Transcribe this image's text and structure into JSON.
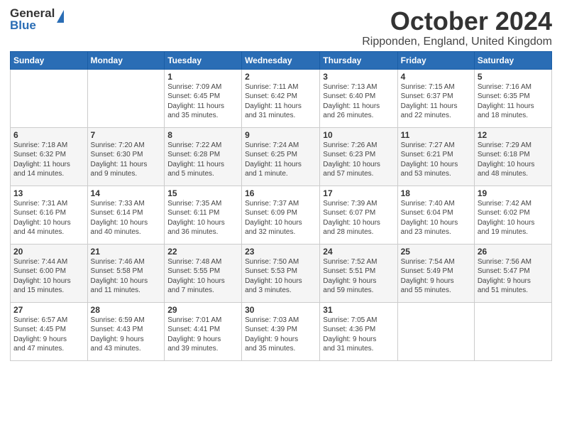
{
  "header": {
    "logo_line1": "General",
    "logo_line2": "Blue",
    "month_title": "October 2024",
    "location": "Ripponden, England, United Kingdom"
  },
  "days_of_week": [
    "Sunday",
    "Monday",
    "Tuesday",
    "Wednesday",
    "Thursday",
    "Friday",
    "Saturday"
  ],
  "weeks": [
    [
      {
        "day": "",
        "info": ""
      },
      {
        "day": "",
        "info": ""
      },
      {
        "day": "1",
        "info": "Sunrise: 7:09 AM\nSunset: 6:45 PM\nDaylight: 11 hours\nand 35 minutes."
      },
      {
        "day": "2",
        "info": "Sunrise: 7:11 AM\nSunset: 6:42 PM\nDaylight: 11 hours\nand 31 minutes."
      },
      {
        "day": "3",
        "info": "Sunrise: 7:13 AM\nSunset: 6:40 PM\nDaylight: 11 hours\nand 26 minutes."
      },
      {
        "day": "4",
        "info": "Sunrise: 7:15 AM\nSunset: 6:37 PM\nDaylight: 11 hours\nand 22 minutes."
      },
      {
        "day": "5",
        "info": "Sunrise: 7:16 AM\nSunset: 6:35 PM\nDaylight: 11 hours\nand 18 minutes."
      }
    ],
    [
      {
        "day": "6",
        "info": "Sunrise: 7:18 AM\nSunset: 6:32 PM\nDaylight: 11 hours\nand 14 minutes."
      },
      {
        "day": "7",
        "info": "Sunrise: 7:20 AM\nSunset: 6:30 PM\nDaylight: 11 hours\nand 9 minutes."
      },
      {
        "day": "8",
        "info": "Sunrise: 7:22 AM\nSunset: 6:28 PM\nDaylight: 11 hours\nand 5 minutes."
      },
      {
        "day": "9",
        "info": "Sunrise: 7:24 AM\nSunset: 6:25 PM\nDaylight: 11 hours\nand 1 minute."
      },
      {
        "day": "10",
        "info": "Sunrise: 7:26 AM\nSunset: 6:23 PM\nDaylight: 10 hours\nand 57 minutes."
      },
      {
        "day": "11",
        "info": "Sunrise: 7:27 AM\nSunset: 6:21 PM\nDaylight: 10 hours\nand 53 minutes."
      },
      {
        "day": "12",
        "info": "Sunrise: 7:29 AM\nSunset: 6:18 PM\nDaylight: 10 hours\nand 48 minutes."
      }
    ],
    [
      {
        "day": "13",
        "info": "Sunrise: 7:31 AM\nSunset: 6:16 PM\nDaylight: 10 hours\nand 44 minutes."
      },
      {
        "day": "14",
        "info": "Sunrise: 7:33 AM\nSunset: 6:14 PM\nDaylight: 10 hours\nand 40 minutes."
      },
      {
        "day": "15",
        "info": "Sunrise: 7:35 AM\nSunset: 6:11 PM\nDaylight: 10 hours\nand 36 minutes."
      },
      {
        "day": "16",
        "info": "Sunrise: 7:37 AM\nSunset: 6:09 PM\nDaylight: 10 hours\nand 32 minutes."
      },
      {
        "day": "17",
        "info": "Sunrise: 7:39 AM\nSunset: 6:07 PM\nDaylight: 10 hours\nand 28 minutes."
      },
      {
        "day": "18",
        "info": "Sunrise: 7:40 AM\nSunset: 6:04 PM\nDaylight: 10 hours\nand 23 minutes."
      },
      {
        "day": "19",
        "info": "Sunrise: 7:42 AM\nSunset: 6:02 PM\nDaylight: 10 hours\nand 19 minutes."
      }
    ],
    [
      {
        "day": "20",
        "info": "Sunrise: 7:44 AM\nSunset: 6:00 PM\nDaylight: 10 hours\nand 15 minutes."
      },
      {
        "day": "21",
        "info": "Sunrise: 7:46 AM\nSunset: 5:58 PM\nDaylight: 10 hours\nand 11 minutes."
      },
      {
        "day": "22",
        "info": "Sunrise: 7:48 AM\nSunset: 5:55 PM\nDaylight: 10 hours\nand 7 minutes."
      },
      {
        "day": "23",
        "info": "Sunrise: 7:50 AM\nSunset: 5:53 PM\nDaylight: 10 hours\nand 3 minutes."
      },
      {
        "day": "24",
        "info": "Sunrise: 7:52 AM\nSunset: 5:51 PM\nDaylight: 9 hours\nand 59 minutes."
      },
      {
        "day": "25",
        "info": "Sunrise: 7:54 AM\nSunset: 5:49 PM\nDaylight: 9 hours\nand 55 minutes."
      },
      {
        "day": "26",
        "info": "Sunrise: 7:56 AM\nSunset: 5:47 PM\nDaylight: 9 hours\nand 51 minutes."
      }
    ],
    [
      {
        "day": "27",
        "info": "Sunrise: 6:57 AM\nSunset: 4:45 PM\nDaylight: 9 hours\nand 47 minutes."
      },
      {
        "day": "28",
        "info": "Sunrise: 6:59 AM\nSunset: 4:43 PM\nDaylight: 9 hours\nand 43 minutes."
      },
      {
        "day": "29",
        "info": "Sunrise: 7:01 AM\nSunset: 4:41 PM\nDaylight: 9 hours\nand 39 minutes."
      },
      {
        "day": "30",
        "info": "Sunrise: 7:03 AM\nSunset: 4:39 PM\nDaylight: 9 hours\nand 35 minutes."
      },
      {
        "day": "31",
        "info": "Sunrise: 7:05 AM\nSunset: 4:36 PM\nDaylight: 9 hours\nand 31 minutes."
      },
      {
        "day": "",
        "info": ""
      },
      {
        "day": "",
        "info": ""
      }
    ]
  ]
}
